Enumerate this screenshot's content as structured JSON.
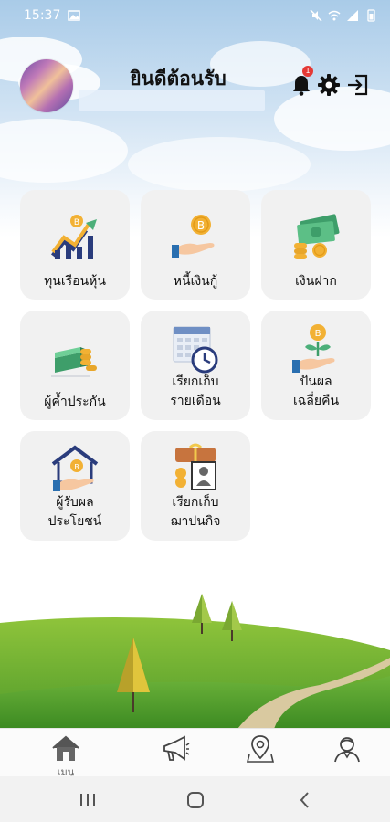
{
  "status_bar": {
    "time": "15:37"
  },
  "header": {
    "welcome_text": "ยินดีต้อนรับ",
    "notification_count": "1",
    "icons": [
      "bell-icon",
      "gear-icon",
      "logout-icon"
    ]
  },
  "menu": {
    "items": [
      {
        "label": "ทุนเรือนหุ้น",
        "icon": "share-capital-chart-icon"
      },
      {
        "label": "หนี้เงินกู้",
        "icon": "loan-hand-coin-icon"
      },
      {
        "label": "เงินฝาก",
        "icon": "deposit-money-icon"
      },
      {
        "label": "ผู้ค้ำประกัน",
        "icon": "guarantor-cash-stack-icon"
      },
      {
        "label": "เรียกเก็บ",
        "label2": "รายเดือน",
        "icon": "monthly-calendar-clock-icon"
      },
      {
        "label": "ปันผล",
        "label2": "เฉลี่ยคืน",
        "icon": "dividend-plant-coin-icon"
      },
      {
        "label": "ผู้รับผล",
        "label2": "ประโยชน์",
        "icon": "beneficiary-house-icon"
      },
      {
        "label": "เรียกเก็บ",
        "label2": "ฌาปนกิจ",
        "icon": "funeral-portrait-icon"
      }
    ]
  },
  "bottom_nav": {
    "items": [
      {
        "label": "เมนู",
        "icon": "home-icon",
        "active": true
      },
      {
        "label": "",
        "icon": "megaphone-icon",
        "active": false
      },
      {
        "label": "",
        "icon": "map-pin-icon",
        "active": false
      },
      {
        "label": "",
        "icon": "profile-icon",
        "active": false
      }
    ]
  },
  "colors": {
    "card_bg": "#f1f1f1",
    "coin": "#f2b134",
    "money_green": "#4caf7a",
    "badge_red": "#e53935"
  }
}
